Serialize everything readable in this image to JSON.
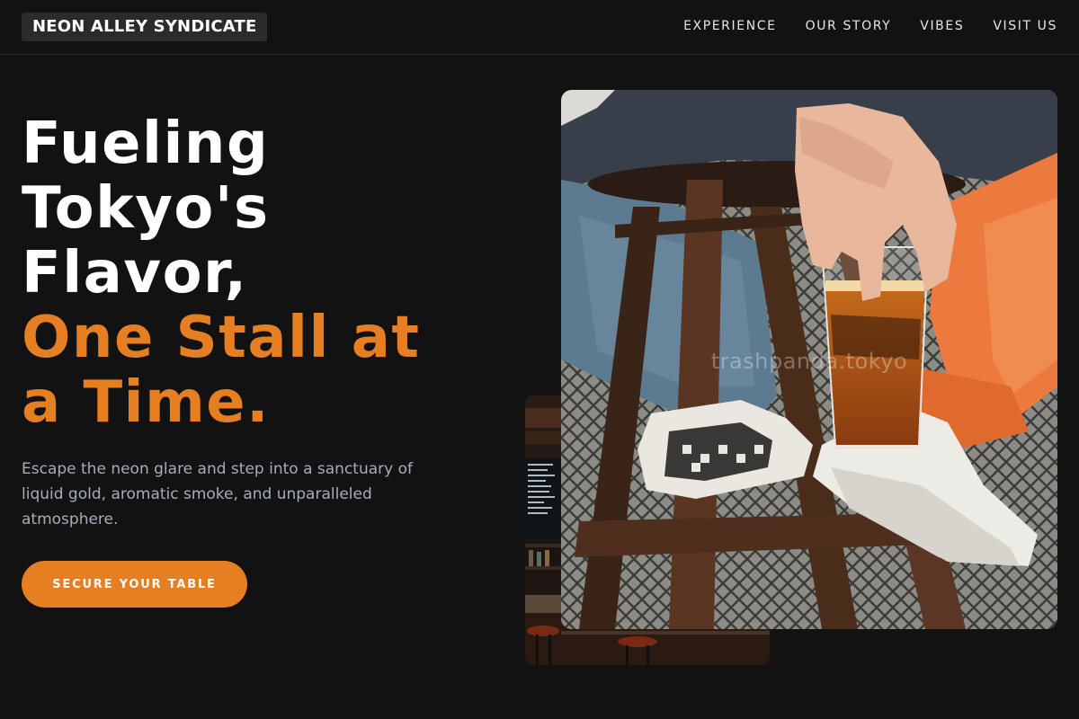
{
  "brand": {
    "logo_text": "NEON ALLEY SYNDICATE"
  },
  "nav": {
    "items": [
      "EXPERIENCE",
      "OUR STORY",
      "VIBES",
      "VISIT US"
    ]
  },
  "hero": {
    "headline_lines": [
      "Fueling",
      "Tokyo's",
      "Flavor,"
    ],
    "headline_accent_lines": [
      "One Stall at",
      "a Time."
    ],
    "subtext": "Escape the neon glare and step into a sanctuary of liquid gold, aromatic smoke, and unparalleled atmosphere.",
    "cta_label": "SECURE YOUR TABLE"
  },
  "photos": {
    "front_watermark": "trashpanda.tokyo"
  },
  "colors": {
    "accent": "#e67e22",
    "background": "#121212",
    "muted_text": "#a4adbd"
  }
}
